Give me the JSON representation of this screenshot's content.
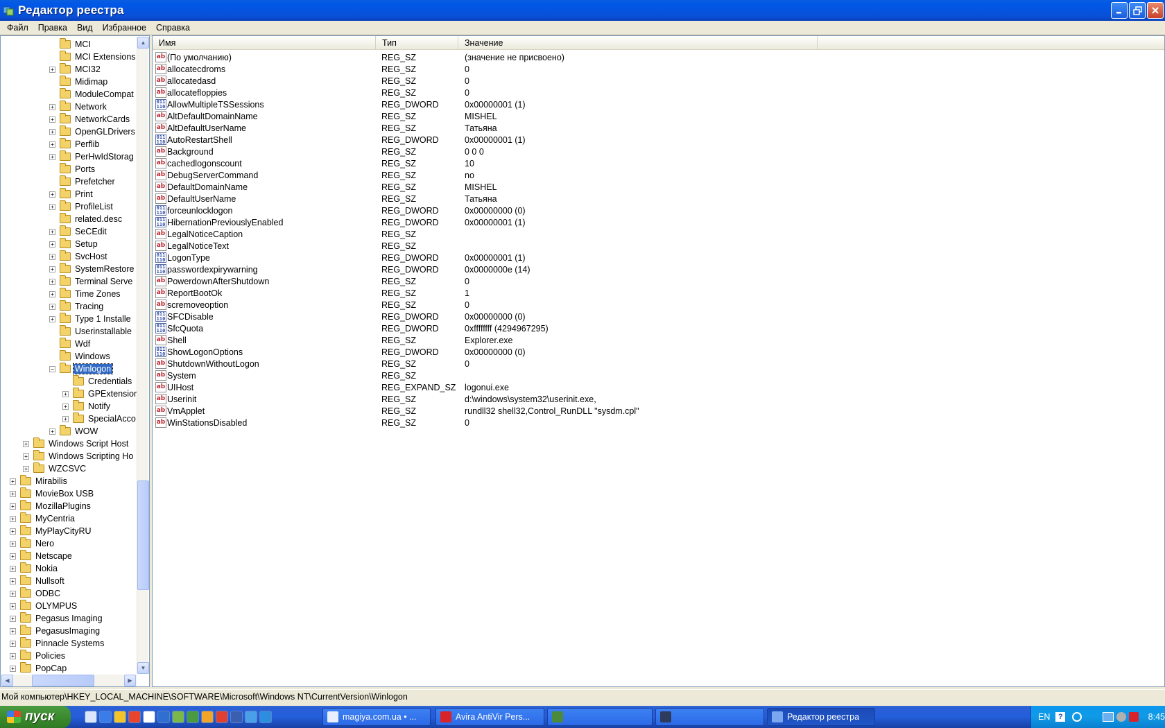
{
  "window": {
    "title": "Редактор реестра",
    "buttons": [
      "minimize-button",
      "maximize-button",
      "close-button"
    ]
  },
  "menu": [
    "Файл",
    "Правка",
    "Вид",
    "Избранное",
    "Справка"
  ],
  "tree": [
    {
      "label": "MCI",
      "level": 4,
      "exp": "none"
    },
    {
      "label": "MCI Extensions",
      "level": 4,
      "exp": "none"
    },
    {
      "label": "MCI32",
      "level": 4,
      "exp": "plus"
    },
    {
      "label": "Midimap",
      "level": 4,
      "exp": "none"
    },
    {
      "label": "ModuleCompat",
      "level": 4,
      "exp": "none"
    },
    {
      "label": "Network",
      "level": 4,
      "exp": "plus"
    },
    {
      "label": "NetworkCards",
      "level": 4,
      "exp": "plus"
    },
    {
      "label": "OpenGLDrivers",
      "level": 4,
      "exp": "plus"
    },
    {
      "label": "Perflib",
      "level": 4,
      "exp": "plus"
    },
    {
      "label": "PerHwIdStorag",
      "level": 4,
      "exp": "plus"
    },
    {
      "label": "Ports",
      "level": 4,
      "exp": "none"
    },
    {
      "label": "Prefetcher",
      "level": 4,
      "exp": "none"
    },
    {
      "label": "Print",
      "level": 4,
      "exp": "plus"
    },
    {
      "label": "ProfileList",
      "level": 4,
      "exp": "plus"
    },
    {
      "label": "related.desc",
      "level": 4,
      "exp": "none"
    },
    {
      "label": "SeCEdit",
      "level": 4,
      "exp": "plus"
    },
    {
      "label": "Setup",
      "level": 4,
      "exp": "plus"
    },
    {
      "label": "SvcHost",
      "level": 4,
      "exp": "plus"
    },
    {
      "label": "SystemRestore",
      "level": 4,
      "exp": "plus"
    },
    {
      "label": "Terminal Serve",
      "level": 4,
      "exp": "plus"
    },
    {
      "label": "Time Zones",
      "level": 4,
      "exp": "plus"
    },
    {
      "label": "Tracing",
      "level": 4,
      "exp": "plus"
    },
    {
      "label": "Type 1 Installe",
      "level": 4,
      "exp": "plus"
    },
    {
      "label": "Userinstallable",
      "level": 4,
      "exp": "none"
    },
    {
      "label": "Wdf",
      "level": 4,
      "exp": "none"
    },
    {
      "label": "Windows",
      "level": 4,
      "exp": "none"
    },
    {
      "label": "Winlogon",
      "level": 4,
      "exp": "minus",
      "selected": true
    },
    {
      "label": "Credentials",
      "level": 5,
      "exp": "none"
    },
    {
      "label": "GPExtensior",
      "level": 5,
      "exp": "plus"
    },
    {
      "label": "Notify",
      "level": 5,
      "exp": "plus"
    },
    {
      "label": "SpecialAcco",
      "level": 5,
      "exp": "plus"
    },
    {
      "label": "WOW",
      "level": 4,
      "exp": "plus"
    },
    {
      "label": "Windows Script Host",
      "level": 2,
      "exp": "plus"
    },
    {
      "label": "Windows Scripting Ho",
      "level": 2,
      "exp": "plus"
    },
    {
      "label": "WZCSVC",
      "level": 2,
      "exp": "plus"
    },
    {
      "label": "Mirabilis",
      "level": 1,
      "exp": "plus"
    },
    {
      "label": "MovieBox USB",
      "level": 1,
      "exp": "plus"
    },
    {
      "label": "MozillaPlugins",
      "level": 1,
      "exp": "plus"
    },
    {
      "label": "MyCentria",
      "level": 1,
      "exp": "plus"
    },
    {
      "label": "MyPlayCityRU",
      "level": 1,
      "exp": "plus"
    },
    {
      "label": "Nero",
      "level": 1,
      "exp": "plus"
    },
    {
      "label": "Netscape",
      "level": 1,
      "exp": "plus"
    },
    {
      "label": "Nokia",
      "level": 1,
      "exp": "plus"
    },
    {
      "label": "Nullsoft",
      "level": 1,
      "exp": "plus"
    },
    {
      "label": "ODBC",
      "level": 1,
      "exp": "plus"
    },
    {
      "label": "OLYMPUS",
      "level": 1,
      "exp": "plus"
    },
    {
      "label": "Pegasus Imaging",
      "level": 1,
      "exp": "plus"
    },
    {
      "label": "PegasusImaging",
      "level": 1,
      "exp": "plus"
    },
    {
      "label": "Pinnacle Systems",
      "level": 1,
      "exp": "plus"
    },
    {
      "label": "Policies",
      "level": 1,
      "exp": "plus"
    },
    {
      "label": "PopCap",
      "level": 1,
      "exp": "plus"
    }
  ],
  "list": {
    "columns": [
      "Имя",
      "Тип",
      "Значение"
    ],
    "rows": [
      {
        "name": "(По умолчанию)",
        "type": "REG_SZ",
        "value": "(значение не присвоено)",
        "icon": "sz"
      },
      {
        "name": "allocatecdroms",
        "type": "REG_SZ",
        "value": "0",
        "icon": "sz"
      },
      {
        "name": "allocatedasd",
        "type": "REG_SZ",
        "value": "0",
        "icon": "sz"
      },
      {
        "name": "allocatefloppies",
        "type": "REG_SZ",
        "value": "0",
        "icon": "sz"
      },
      {
        "name": "AllowMultipleTSSessions",
        "type": "REG_DWORD",
        "value": "0x00000001 (1)",
        "icon": "dword"
      },
      {
        "name": "AltDefaultDomainName",
        "type": "REG_SZ",
        "value": "MISHEL",
        "icon": "sz"
      },
      {
        "name": "AltDefaultUserName",
        "type": "REG_SZ",
        "value": "Татьяна",
        "icon": "sz"
      },
      {
        "name": "AutoRestartShell",
        "type": "REG_DWORD",
        "value": "0x00000001 (1)",
        "icon": "dword"
      },
      {
        "name": "Background",
        "type": "REG_SZ",
        "value": "0 0 0",
        "icon": "sz"
      },
      {
        "name": "cachedlogonscount",
        "type": "REG_SZ",
        "value": "10",
        "icon": "sz"
      },
      {
        "name": "DebugServerCommand",
        "type": "REG_SZ",
        "value": "no",
        "icon": "sz"
      },
      {
        "name": "DefaultDomainName",
        "type": "REG_SZ",
        "value": "MISHEL",
        "icon": "sz"
      },
      {
        "name": "DefaultUserName",
        "type": "REG_SZ",
        "value": "Татьяна",
        "icon": "sz"
      },
      {
        "name": "forceunlocklogon",
        "type": "REG_DWORD",
        "value": "0x00000000 (0)",
        "icon": "dword"
      },
      {
        "name": "HibernationPreviouslyEnabled",
        "type": "REG_DWORD",
        "value": "0x00000001 (1)",
        "icon": "dword"
      },
      {
        "name": "LegalNoticeCaption",
        "type": "REG_SZ",
        "value": "",
        "icon": "sz"
      },
      {
        "name": "LegalNoticeText",
        "type": "REG_SZ",
        "value": "",
        "icon": "sz"
      },
      {
        "name": "LogonType",
        "type": "REG_DWORD",
        "value": "0x00000001 (1)",
        "icon": "dword"
      },
      {
        "name": "passwordexpirywarning",
        "type": "REG_DWORD",
        "value": "0x0000000e (14)",
        "icon": "dword"
      },
      {
        "name": "PowerdownAfterShutdown",
        "type": "REG_SZ",
        "value": "0",
        "icon": "sz"
      },
      {
        "name": "ReportBootOk",
        "type": "REG_SZ",
        "value": "1",
        "icon": "sz"
      },
      {
        "name": "scremoveoption",
        "type": "REG_SZ",
        "value": "0",
        "icon": "sz"
      },
      {
        "name": "SFCDisable",
        "type": "REG_DWORD",
        "value": "0x00000000 (0)",
        "icon": "dword"
      },
      {
        "name": "SfcQuota",
        "type": "REG_DWORD",
        "value": "0xffffffff (4294967295)",
        "icon": "dword"
      },
      {
        "name": "Shell",
        "type": "REG_SZ",
        "value": "Explorer.exe",
        "icon": "sz"
      },
      {
        "name": "ShowLogonOptions",
        "type": "REG_DWORD",
        "value": "0x00000000 (0)",
        "icon": "dword"
      },
      {
        "name": "ShutdownWithoutLogon",
        "type": "REG_SZ",
        "value": "0",
        "icon": "sz"
      },
      {
        "name": "System",
        "type": "REG_SZ",
        "value": "",
        "icon": "sz"
      },
      {
        "name": "UIHost",
        "type": "REG_EXPAND_SZ",
        "value": "logonui.exe",
        "icon": "sz"
      },
      {
        "name": "Userinit",
        "type": "REG_SZ",
        "value": "d:\\windows\\system32\\userinit.exe,",
        "icon": "sz"
      },
      {
        "name": "VmApplet",
        "type": "REG_SZ",
        "value": "rundll32 shell32,Control_RunDLL \"sysdm.cpl\"",
        "icon": "sz"
      },
      {
        "name": "WinStationsDisabled",
        "type": "REG_SZ",
        "value": "0",
        "icon": "sz"
      }
    ]
  },
  "status": "Мой компьютер\\HKEY_LOCAL_MACHINE\\SOFTWARE\\Microsoft\\Windows NT\\CurrentVersion\\Winlogon",
  "taskbar": {
    "start_label": "пуск",
    "quicklaunch": [
      "ql-icon-1",
      "ql-icon-2",
      "ql-icon-3",
      "ql-icon-4",
      "ql-icon-5",
      "ql-icon-6",
      "ql-icon-7",
      "ql-icon-8",
      "ql-icon-9",
      "ql-icon-10",
      "ql-icon-11",
      "ql-icon-12",
      "ql-icon-13"
    ],
    "buttons": [
      {
        "label": "magiya.com.ua • ...",
        "icon_color": "#e9eefc"
      },
      {
        "label": "Avira AntiVir Pers...",
        "icon_color": "#d8232a"
      },
      {
        "label": "",
        "icon_color": "#4a8a3a"
      },
      {
        "label": "",
        "icon_color": "#2f3b5c"
      },
      {
        "label": "Редактор реестра",
        "icon_color": "#7aa7f0",
        "active": true
      }
    ],
    "tray_lang": "EN",
    "clock": "8:45"
  }
}
